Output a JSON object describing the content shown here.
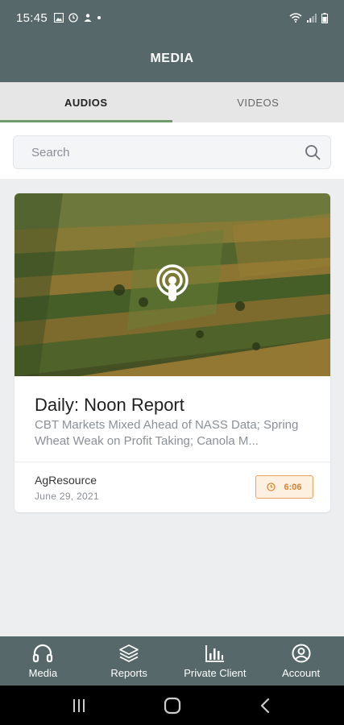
{
  "status_bar": {
    "time": "15:45",
    "left_icons": [
      "image-icon",
      "alarm-icon",
      "person-notification-icon",
      "dot-icon"
    ],
    "right_icons": [
      "wifi-icon",
      "signal-icon",
      "battery-icon"
    ]
  },
  "app_bar": {
    "title": "MEDIA"
  },
  "tabs": [
    {
      "label": "AUDIOS",
      "active": true
    },
    {
      "label": "VIDEOS",
      "active": false
    }
  ],
  "search": {
    "placeholder": "Search",
    "icon": "search-icon"
  },
  "media_items": [
    {
      "title": "Daily: Noon Report",
      "description": "CBT Markets Mixed Ahead of NASS Data; Spring Wheat Weak on Profit Taking; Canola M...",
      "author": "AgResource",
      "date": "June 29, 2021",
      "duration": "6:06",
      "thumbnail_icon": "podcast-icon"
    }
  ],
  "bottom_nav": [
    {
      "label": "Media",
      "icon": "headphones-icon",
      "active": true
    },
    {
      "label": "Reports",
      "icon": "layers-icon",
      "active": false
    },
    {
      "label": "Private Client",
      "icon": "bar-chart-icon",
      "active": false
    },
    {
      "label": "Account",
      "icon": "account-icon",
      "active": false
    }
  ],
  "system_nav": [
    "recent-apps-icon",
    "home-icon",
    "back-icon"
  ],
  "colors": {
    "header": "#56686a",
    "tab_indicator": "#6f9b6b",
    "duration_accent": "#e9a35c",
    "background": "#eceef0"
  }
}
